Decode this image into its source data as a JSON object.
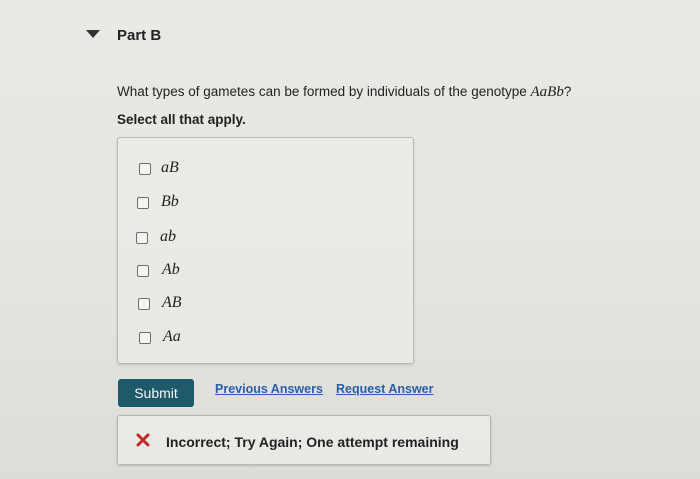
{
  "part": {
    "title": "Part B",
    "toggle_icon": "caret-down-icon"
  },
  "question": {
    "text": "What types of gametes can be formed by individuals of the genotype ",
    "genotype": "AaBb",
    "suffix": "?",
    "instruction": "Select all that apply."
  },
  "options": [
    {
      "label": "aB",
      "checked": false
    },
    {
      "label": "Bb",
      "checked": false
    },
    {
      "label": "ab",
      "checked": false
    },
    {
      "label": "Ab",
      "checked": false
    },
    {
      "label": "AB",
      "checked": false
    },
    {
      "label": "Aa",
      "checked": false
    }
  ],
  "actions": {
    "submit_label": "Submit",
    "previous_answers_label": "Previous Answers",
    "request_answer_label": "Request Answer"
  },
  "feedback": {
    "icon": "x-mark-icon",
    "text": "Incorrect; Try Again; One attempt remaining",
    "icon_color": "#c0282a"
  },
  "colors": {
    "submit_bg": "#1f5a6a",
    "link": "#2a5fa8"
  }
}
